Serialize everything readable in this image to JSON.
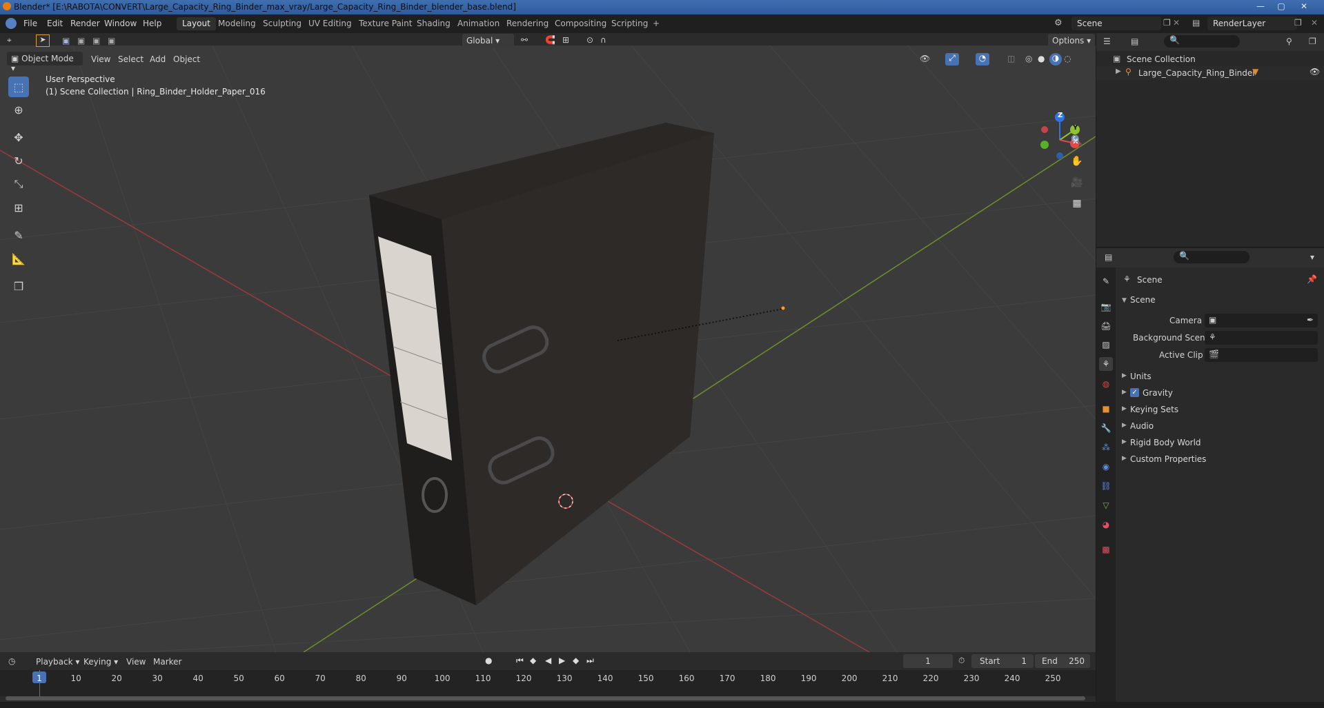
{
  "window": {
    "title": "Blender* [E:\\RABOTA\\CONVERT\\Large_Capacity_Ring_Binder_max_vray/Large_Capacity_Ring_Binder_blender_base.blend]",
    "minimize": "—",
    "maximize": "▢",
    "close": "✕"
  },
  "menu": [
    "File",
    "Edit",
    "Render",
    "Window",
    "Help"
  ],
  "workspaces": [
    "Layout",
    "Modeling",
    "Sculpting",
    "UV Editing",
    "Texture Paint",
    "Shading",
    "Animation",
    "Rendering",
    "Compositing",
    "Scripting"
  ],
  "active_workspace": "Layout",
  "add_workspace": "+",
  "scene_name": "Scene",
  "render_layer": "RenderLayer",
  "viewport_header": {
    "mode": "Object Mode",
    "menus": [
      "View",
      "Select",
      "Add",
      "Object"
    ],
    "orientation": "Global",
    "options": "Options"
  },
  "viewport": {
    "perspective_label": "User Perspective",
    "collection_label": "(1) Scene Collection | Ring_Binder_Holder_Paper_016",
    "gizmo": {
      "z": "Z",
      "y": "Y",
      "x": "X"
    }
  },
  "outliner": {
    "root": "Scene Collection",
    "items": [
      "Large_Capacity_Ring_Binder"
    ]
  },
  "properties": {
    "header": "Scene",
    "section": "Scene",
    "fields": [
      {
        "label": "Camera",
        "value": ""
      },
      {
        "label": "Background Scene",
        "value": ""
      },
      {
        "label": "Active Clip",
        "value": ""
      }
    ],
    "panels": [
      "Units",
      "Gravity",
      "Keying Sets",
      "Audio",
      "Rigid Body World",
      "Custom Properties"
    ],
    "gravity_checked": true
  },
  "timeline": {
    "menus": [
      "Playback",
      "Keying",
      "View",
      "Marker"
    ],
    "current_frame": "1",
    "start_label": "Start",
    "start": "1",
    "end_label": "End",
    "end": "250",
    "ticks": [
      "1",
      "10",
      "20",
      "30",
      "40",
      "50",
      "60",
      "70",
      "80",
      "90",
      "100",
      "110",
      "120",
      "130",
      "140",
      "150",
      "160",
      "170",
      "180",
      "190",
      "200",
      "210",
      "220",
      "230",
      "240",
      "250"
    ]
  }
}
